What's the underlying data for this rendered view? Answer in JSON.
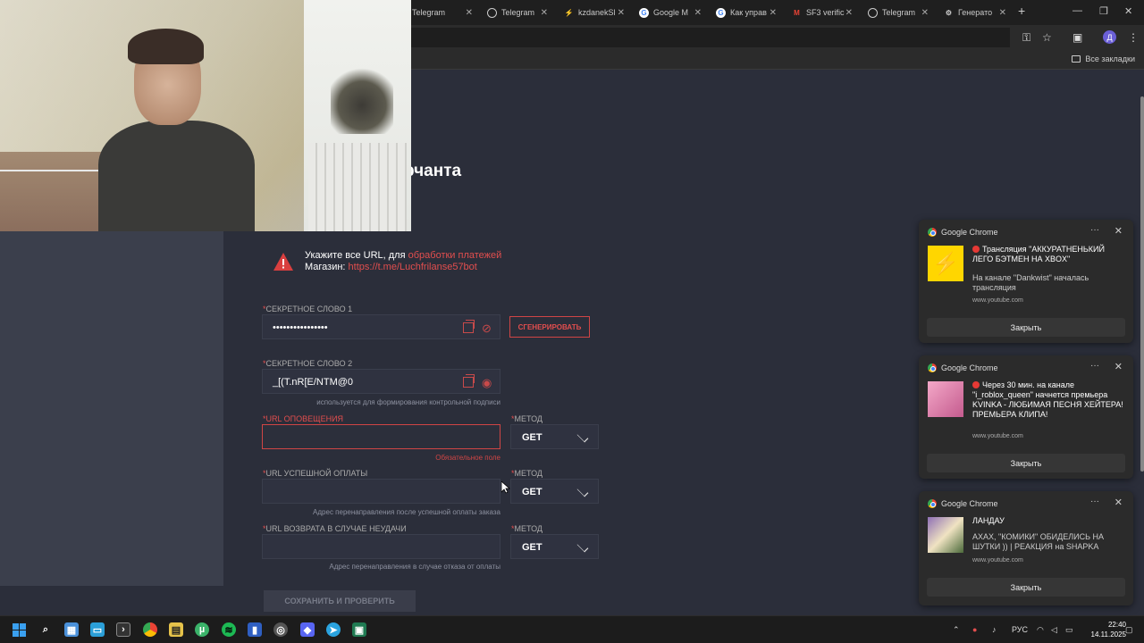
{
  "browser": {
    "tabs": [
      {
        "label": "Telegram",
        "icon": "telegram-icon"
      },
      {
        "label": "Telegram",
        "icon": "globe-icon"
      },
      {
        "label": "kzdanekSl",
        "icon": "kz-icon"
      },
      {
        "label": "Google M",
        "icon": "google-icon"
      },
      {
        "label": "Как управ",
        "icon": "google-icon"
      },
      {
        "label": "SF3 verific",
        "icon": "gmail-icon"
      },
      {
        "label": "Telegram",
        "icon": "globe-icon"
      },
      {
        "label": "Генерато",
        "icon": "gear-icon"
      }
    ],
    "new_tab": "+",
    "avatar_letter": "Д",
    "all_bookmarks": "Все закладки"
  },
  "page": {
    "title": "рчанта",
    "warning": {
      "line1_prefix": "Укажите все URL, для ",
      "line1_link": "обработки платежей",
      "line2_prefix": "Магазин: ",
      "line2_link": "https://t.me/Luchfrilanse57bot"
    },
    "secret1": {
      "label_star": "*",
      "label": "Секретное слово 1",
      "value": "••••••••••••••••"
    },
    "generate_button": "Сгенерировать",
    "secret2": {
      "label_star": "*",
      "label": "Секретное слово 2",
      "value": "_[(T.nR[E/NTM@0",
      "hint": "используется для формирования контрольной подписи"
    },
    "notify_url": {
      "label": "*URL оповещения",
      "value": "",
      "hint": "Обязательное поле"
    },
    "success_url": {
      "label_star": "*",
      "label": "URL успешной оплаты",
      "value": "",
      "hint": "Адрес перенаправления после успешной оплаты заказа"
    },
    "fail_url": {
      "label_star": "*",
      "label": "URL возврата в случае неудачи",
      "value": "",
      "hint": "Адрес перенаправления в случае отказа от оплаты"
    },
    "method_label_star": "*",
    "method_label": "Метод",
    "method_value": "GET",
    "save_button": "Сохранить и проверить"
  },
  "notifications": [
    {
      "app": "Google Chrome",
      "title": "Трансляция \"АККУРАТНЕНЬКИЙ ЛЕГО БЭТМЕН НА XBOX\"",
      "body": "На канале \"Dankwist\" началась трансляция",
      "site": "www.youtube.com",
      "button": "Закрыть"
    },
    {
      "app": "Google Chrome",
      "title": "Через 30 мин. на канале \"i_roblox_queen\" начнется премьера KVINKA - ЛЮБИМАЯ ПЕСНЯ ХЕЙТЕРА! ПРЕМЬЕРА КЛИПА!",
      "body": "",
      "site": "www.youtube.com",
      "button": "Закрыть"
    },
    {
      "app": "Google Chrome",
      "title": "ЛАНДАУ",
      "body": "АХАХ, \"КОМИКИ\" ОБИДЕЛИСЬ НА ШУТКИ )) | РЕАКЦИЯ на SHAPKA",
      "site": "www.youtube.com",
      "button": "Закрыть"
    }
  ],
  "taskbar": {
    "lang": "РУС",
    "time": "22:40",
    "date": "14.11.2025"
  },
  "colors": {
    "accent_red": "#e24e4e",
    "page_bg": "#2b2e3a",
    "field_bg": "#2f3240"
  }
}
